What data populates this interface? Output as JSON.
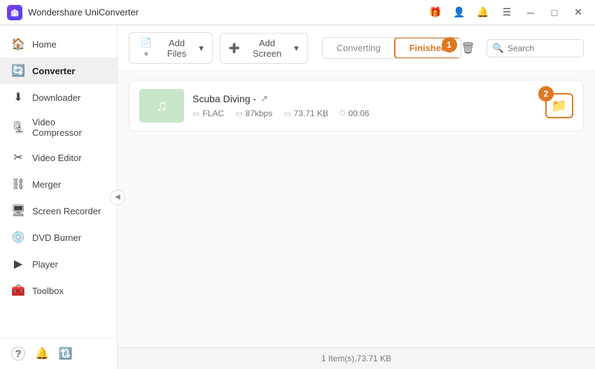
{
  "app": {
    "title": "Wondershare UniConverter"
  },
  "titlebar": {
    "controls": {
      "minimize": "─",
      "maximize": "□",
      "close": "✕"
    }
  },
  "sidebar": {
    "items": [
      {
        "id": "home",
        "label": "Home",
        "icon": "🏠"
      },
      {
        "id": "converter",
        "label": "Converter",
        "icon": "🔄",
        "active": true
      },
      {
        "id": "downloader",
        "label": "Downloader",
        "icon": "⬇"
      },
      {
        "id": "video-compressor",
        "label": "Video Compressor",
        "icon": "🗜"
      },
      {
        "id": "video-editor",
        "label": "Video Editor",
        "icon": "✂"
      },
      {
        "id": "merger",
        "label": "Merger",
        "icon": "⛓"
      },
      {
        "id": "screen-recorder",
        "label": "Screen Recorder",
        "icon": "🖥"
      },
      {
        "id": "dvd-burner",
        "label": "DVD Burner",
        "icon": "💿"
      },
      {
        "id": "player",
        "label": "Player",
        "icon": "▶"
      },
      {
        "id": "toolbox",
        "label": "Toolbox",
        "icon": "🧰"
      }
    ],
    "footer": {
      "help_icon": "?",
      "bell_icon": "🔔",
      "refresh_icon": "🔃"
    }
  },
  "toolbar": {
    "add_files_label": "Add Files",
    "add_screen_label": "Add Screen",
    "tabs": {
      "converting_label": "Converting",
      "finished_label": "Finished"
    },
    "search_placeholder": "Search",
    "badge_converting": "1",
    "badge_finished": "1"
  },
  "file_list": {
    "items": [
      {
        "name": "Scuba Diving -",
        "format": "FLAC",
        "bitrate": "87kbps",
        "size": "73.71 KB",
        "duration": "00:06",
        "badge_number": "2"
      }
    ]
  },
  "statusbar": {
    "text": "1 Item(s),73.71 KB"
  }
}
